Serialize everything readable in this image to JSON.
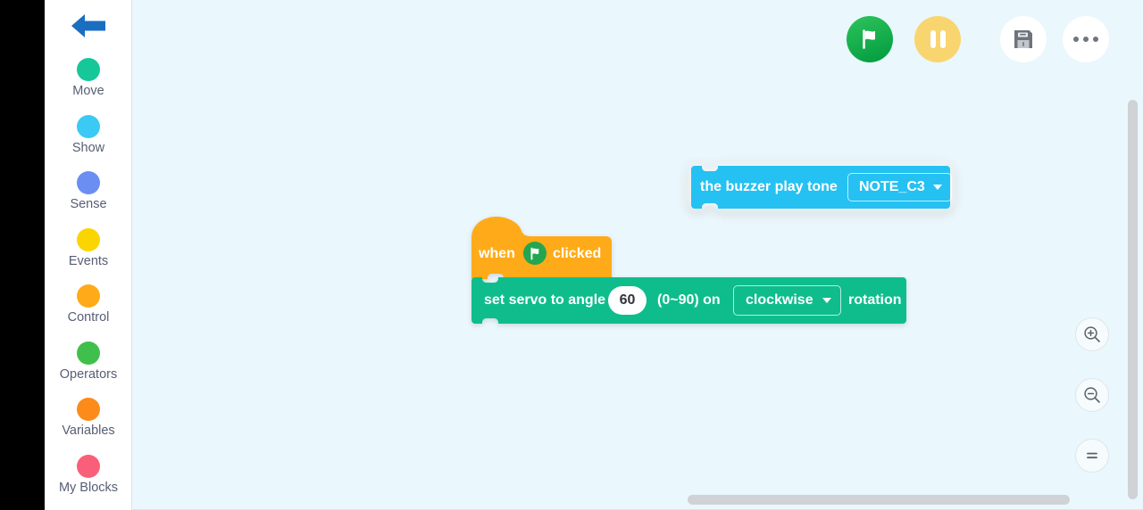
{
  "window": {
    "background_color": "#000000",
    "canvas_color": "#eaf7fc"
  },
  "sidebar": {
    "back_label": "back-arrow",
    "items": [
      {
        "label": "Move",
        "color": "#16c79a",
        "icon": "category-dot-move"
      },
      {
        "label": "Show",
        "color": "#3bc9f5",
        "icon": "category-dot-show"
      },
      {
        "label": "Sense",
        "color": "#6a8ef2",
        "icon": "category-dot-sense"
      },
      {
        "label": "Events",
        "color": "#fad500",
        "icon": "category-dot-events"
      },
      {
        "label": "Control",
        "color": "#ffab19",
        "icon": "category-dot-control"
      },
      {
        "label": "Operators",
        "color": "#41bf4c",
        "icon": "category-dot-operators"
      },
      {
        "label": "Variables",
        "color": "#fc8b1a",
        "icon": "category-dot-variables"
      },
      {
        "label": "My Blocks",
        "color": "#fa5f7a",
        "icon": "category-dot-my-blocks"
      }
    ]
  },
  "toolbar": {
    "run_label": "green-flag-run",
    "pause_label": "pause",
    "save_label": "save",
    "more_label": "more-options"
  },
  "blocks": {
    "buzzer": {
      "color": "#25c1f2",
      "text": "the buzzer play tone",
      "note_value": "NOTE_C3",
      "selected": true
    },
    "hat": {
      "color": "#ffab19",
      "text_before": "when",
      "text_after": "clicked",
      "icon": "green-flag-icon"
    },
    "servo": {
      "color": "#0fbd8c",
      "text_before": "set servo to angle",
      "angle_value": "60",
      "range_text": "(0~90) on",
      "direction_value": "clockwise",
      "text_after": "rotation"
    }
  },
  "zoom_controls": {
    "zoom_in_label": "zoom-in",
    "zoom_out_label": "zoom-out",
    "zoom_reset_label": "zoom-reset"
  }
}
